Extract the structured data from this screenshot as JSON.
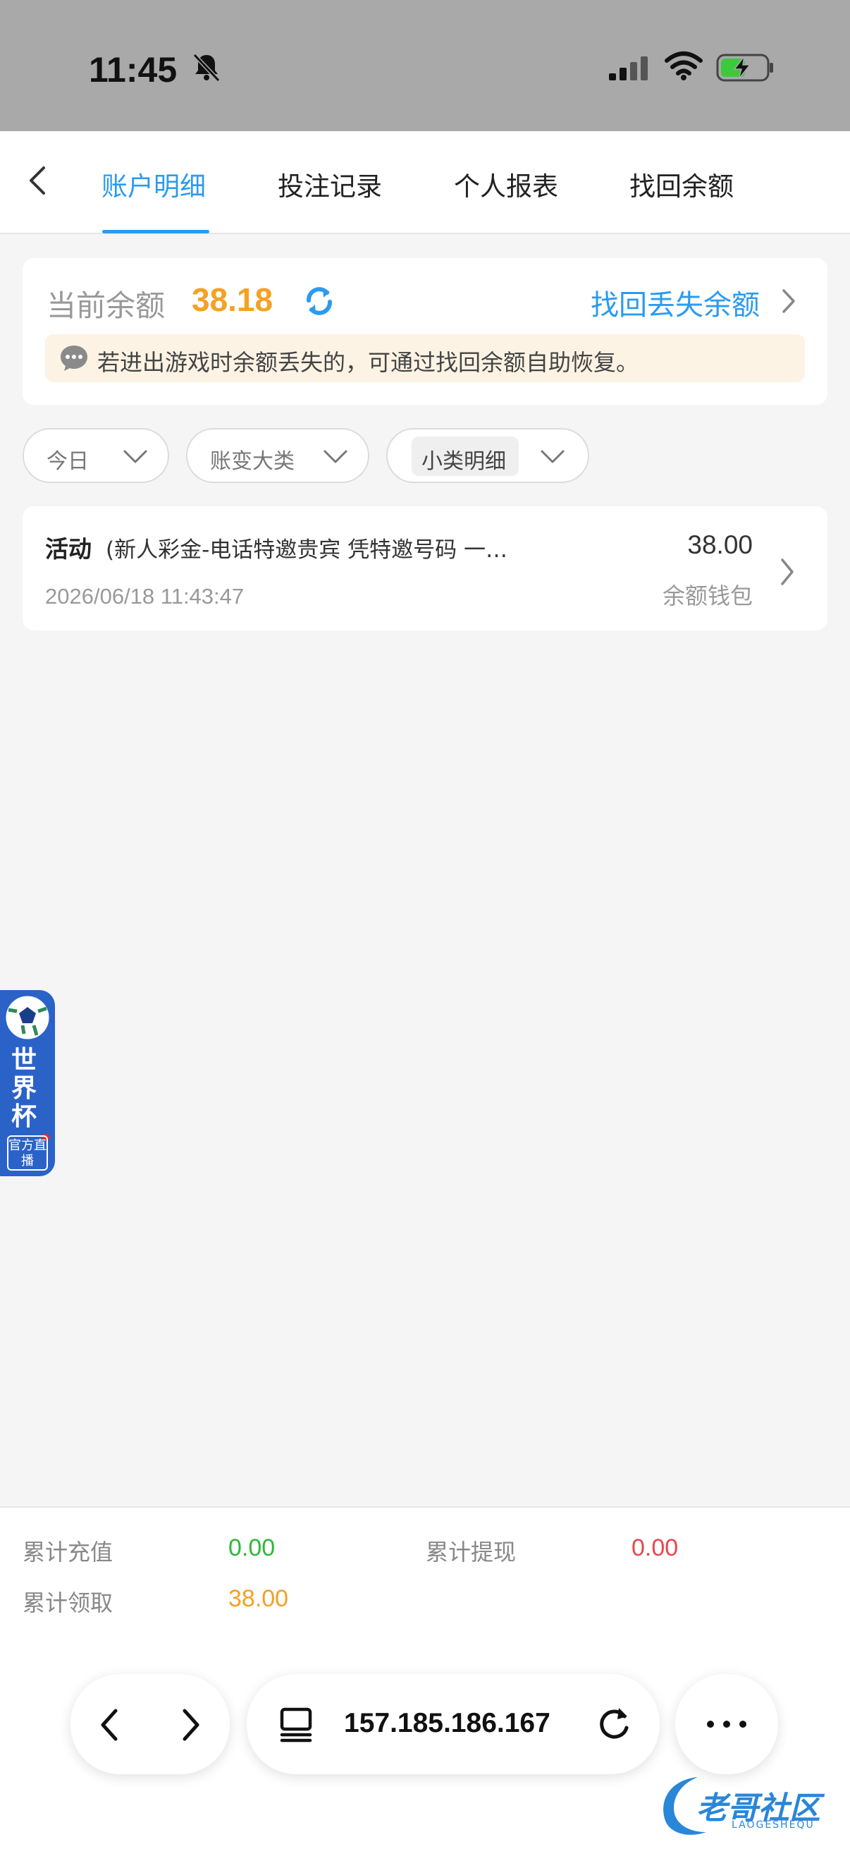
{
  "status_bar": {
    "time": "11:45"
  },
  "nav": {
    "tabs": [
      {
        "label": "账户明细",
        "active": true
      },
      {
        "label": "投注记录",
        "active": false
      },
      {
        "label": "个人报表",
        "active": false
      },
      {
        "label": "找回余额",
        "active": false
      }
    ]
  },
  "balance": {
    "label": "当前余额",
    "value": "38.18",
    "recover_link": "找回丢失余额",
    "notice": "若进出游戏时余额丢失的，可通过找回余额自助恢复。"
  },
  "filters": [
    {
      "label": "今日"
    },
    {
      "label": "账变大类"
    },
    {
      "label": "小类明细"
    }
  ],
  "records": [
    {
      "type": "活动",
      "description": "(新人彩金-电话特邀贵宾 凭特邀号码 一…",
      "time": "2026/06/18 11:43:47",
      "amount": "38.00",
      "wallet": "余额钱包"
    }
  ],
  "floating_badge": {
    "title": "世界杯",
    "tag": "官方直播"
  },
  "summary": {
    "recharge_label": "累计充值",
    "recharge_value": "0.00",
    "withdraw_label": "累计提现",
    "withdraw_value": "0.00",
    "claim_label": "累计领取",
    "claim_value": "38.00"
  },
  "browser": {
    "url": "157.185.186.167"
  },
  "watermark": {
    "text": "老哥社区",
    "sub": "LAOGESHEQU"
  },
  "colors": {
    "accent": "#2b9bf0",
    "balance": "#f5a123",
    "green": "#2eb83a",
    "red": "#e7474a"
  }
}
